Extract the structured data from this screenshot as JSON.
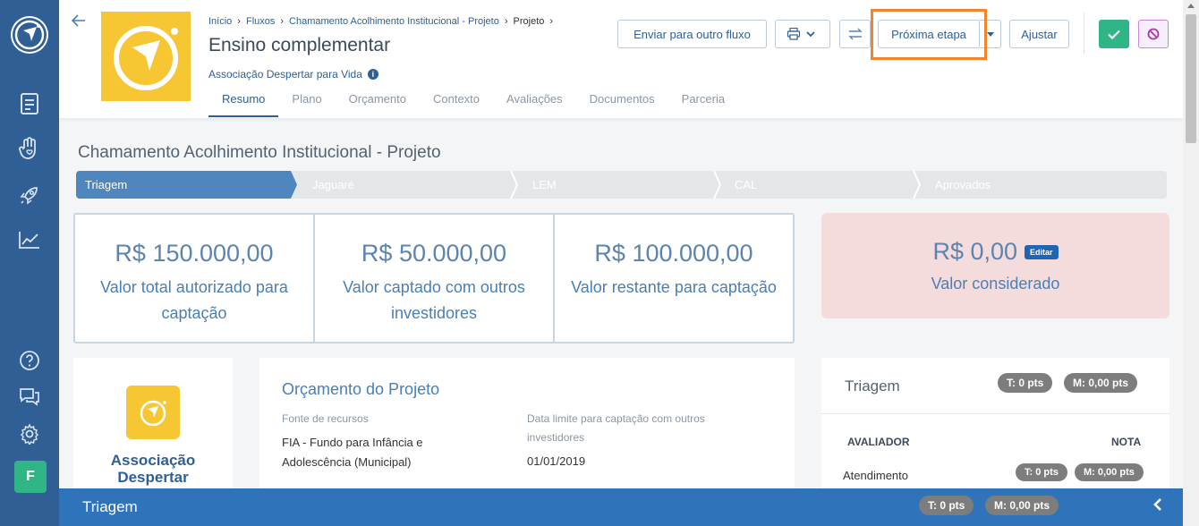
{
  "breadcrumb": [
    "Início",
    "Fluxos",
    "Chamamento Acolhimento Institucional - Projeto",
    "Projeto"
  ],
  "breadcrumb_sep": "›",
  "page": {
    "title": "Ensino complementar",
    "org": "Associação Despertar para Vida",
    "info": "i"
  },
  "tabs": [
    "Resumo",
    "Plano",
    "Orçamento",
    "Contexto",
    "Avaliações",
    "Documentos",
    "Parceria"
  ],
  "actions": {
    "send": "Enviar para outro fluxo",
    "next": "Próxima etapa",
    "adjust": "Ajustar"
  },
  "section": {
    "title": "Chamamento Acolhimento Institucional - Projeto"
  },
  "steps": [
    "Triagem",
    "Jaguaré",
    "LEM",
    "CAL",
    "Aprovados"
  ],
  "stats": [
    {
      "value": "R$ 150.000,00",
      "label": "Valor total autorizado para captação"
    },
    {
      "value": "R$ 50.000,00",
      "label": "Valor captado com outros investidores"
    },
    {
      "value": "R$ 100.000,00",
      "label": "Valor restante para captação"
    }
  ],
  "considered": {
    "value": "R$ 0,00",
    "edit": "Editar",
    "label": "Valor considerado"
  },
  "org_card": {
    "name": "Associação Despertar"
  },
  "budget": {
    "title": "Orçamento do Projeto",
    "source_label": "Fonte de recursos",
    "source_value": "FIA - Fundo para Infância e Adolescência (Municipal)",
    "deadline_label": "Data limite para captação com outros investidores",
    "deadline_value": "01/01/2019"
  },
  "triage": {
    "title": "Triagem",
    "t": "T: 0 pts",
    "m": "M: 0,00 pts",
    "col_evaluator": "AVALIADOR",
    "col_grade": "NOTA",
    "row": {
      "label": "Atendimento",
      "t": "T: 0 pts",
      "m": "M: 0,00 pts"
    }
  },
  "footer": {
    "title": "Triagem",
    "t": "T: 0 pts",
    "m": "M: 0,00 pts"
  },
  "sidebar_avatar": "F",
  "colors": {
    "primary": "#2f5f95",
    "accent": "#f6c633",
    "success": "#2fb586",
    "highlight": "#f2842c"
  }
}
